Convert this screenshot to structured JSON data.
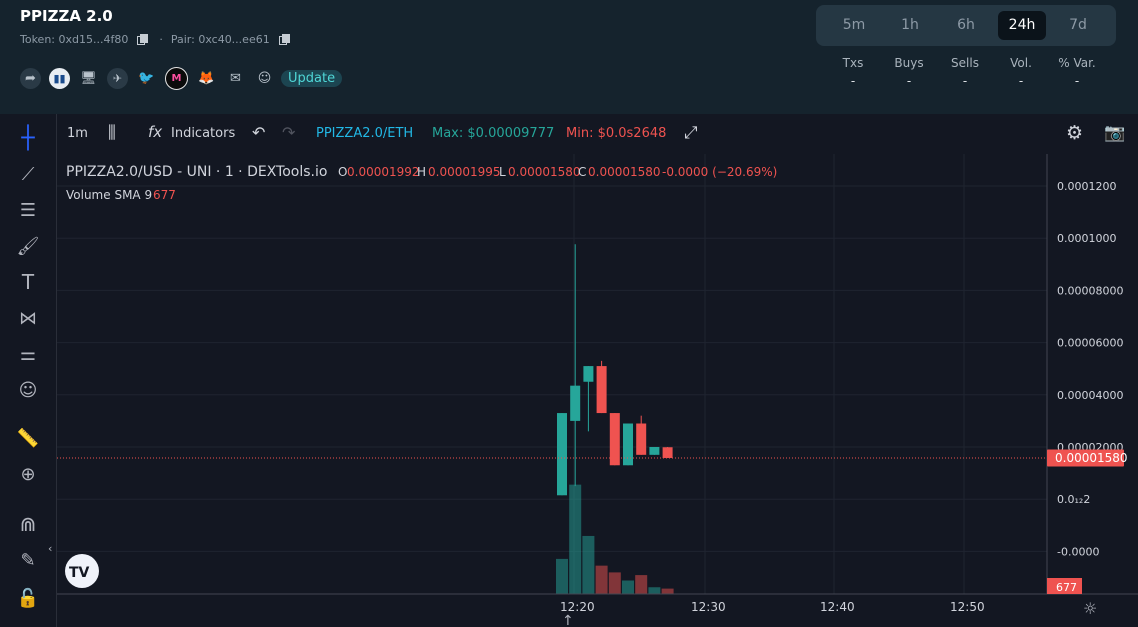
{
  "header": {
    "title": "PPIZZA 2.0",
    "token_label": "Token: 0xd15...4f80",
    "pair_label": "Pair: 0xc40...ee61",
    "update_label": "Update",
    "social_icons": [
      "share-icon",
      "dextools-icon",
      "website-icon",
      "telegram-icon",
      "twitter-icon",
      "market-icon",
      "metamask-icon",
      "email-icon",
      "discord-icon"
    ]
  },
  "timeframes": {
    "items": [
      "5m",
      "1h",
      "6h",
      "24h",
      "7d"
    ],
    "active": "24h"
  },
  "stats": {
    "headers": [
      "Txs",
      "Buys",
      "Sells",
      "Vol.",
      "% Var."
    ],
    "values": [
      "-",
      "-",
      "-",
      "-",
      "-"
    ]
  },
  "toolbar": {
    "interval": "1m",
    "indicators_label": "Indicators",
    "pair": "PPIZZA2.0/ETH",
    "max_label": "Max: $0.00009777",
    "min_label": "Min: $0.0s2648"
  },
  "legend": {
    "symbol": "PPIZZA2.0/USD - UNI · 1 · DEXTools.io",
    "o_label": "O",
    "o_value": "0.00001992",
    "h_label": "H",
    "h_value": "0.00001995",
    "l_label": "L",
    "l_value": "0.00001580",
    "c_label": "C",
    "c_value": "0.00001580",
    "change": "-0.0000 (−20.69%)",
    "volume_label": "Volume SMA 9",
    "volume_value": "677"
  },
  "colors": {
    "up": "#26a69a",
    "down": "#ef5350",
    "accent_cyan": "#22b8e6",
    "max_green": "#26a69a",
    "min_red": "#ef5350"
  },
  "chart_data": {
    "type": "candlestick",
    "price_axis_ticks": [
      "0.0001200",
      "0.0001000",
      "0.00008000",
      "0.00006000",
      "0.00004000",
      "0.00002000",
      "0.0₁₂2",
      "-0.0000"
    ],
    "current_price": "0.00001580",
    "volume_badge": "677",
    "x_ticks": [
      "12:20",
      "12:30",
      "12:40",
      "12:50"
    ],
    "candles": [
      {
        "o": 1.5e-06,
        "h": 3.3e-05,
        "l": 1.5e-06,
        "c": 3.3e-05,
        "v": 0.26
      },
      {
        "o": 3e-05,
        "h": 9.77e-05,
        "l": 5e-06,
        "c": 4.35e-05,
        "v": 0.81
      },
      {
        "o": 4.5e-05,
        "h": 5.1e-05,
        "l": 2.6e-05,
        "c": 5.1e-05,
        "v": 0.43
      },
      {
        "o": 5.1e-05,
        "h": 5.3e-05,
        "l": 3.3e-05,
        "c": 3.3e-05,
        "v": 0.21
      },
      {
        "o": 3.3e-05,
        "h": 3.3e-05,
        "l": 1.3e-05,
        "c": 1.3e-05,
        "v": 0.16
      },
      {
        "o": 1.3e-05,
        "h": 2.9e-05,
        "l": 1.3e-05,
        "c": 2.9e-05,
        "v": 0.1
      },
      {
        "o": 2.9e-05,
        "h": 3.2e-05,
        "l": 1.7e-05,
        "c": 1.7e-05,
        "v": 0.14
      },
      {
        "o": 1.7e-05,
        "h": 2e-05,
        "l": 1.7e-05,
        "c": 2e-05,
        "v": 0.05
      },
      {
        "o": 1.99e-05,
        "h": 2e-05,
        "l": 1.58e-05,
        "c": 1.58e-05,
        "v": 0.04
      }
    ]
  }
}
